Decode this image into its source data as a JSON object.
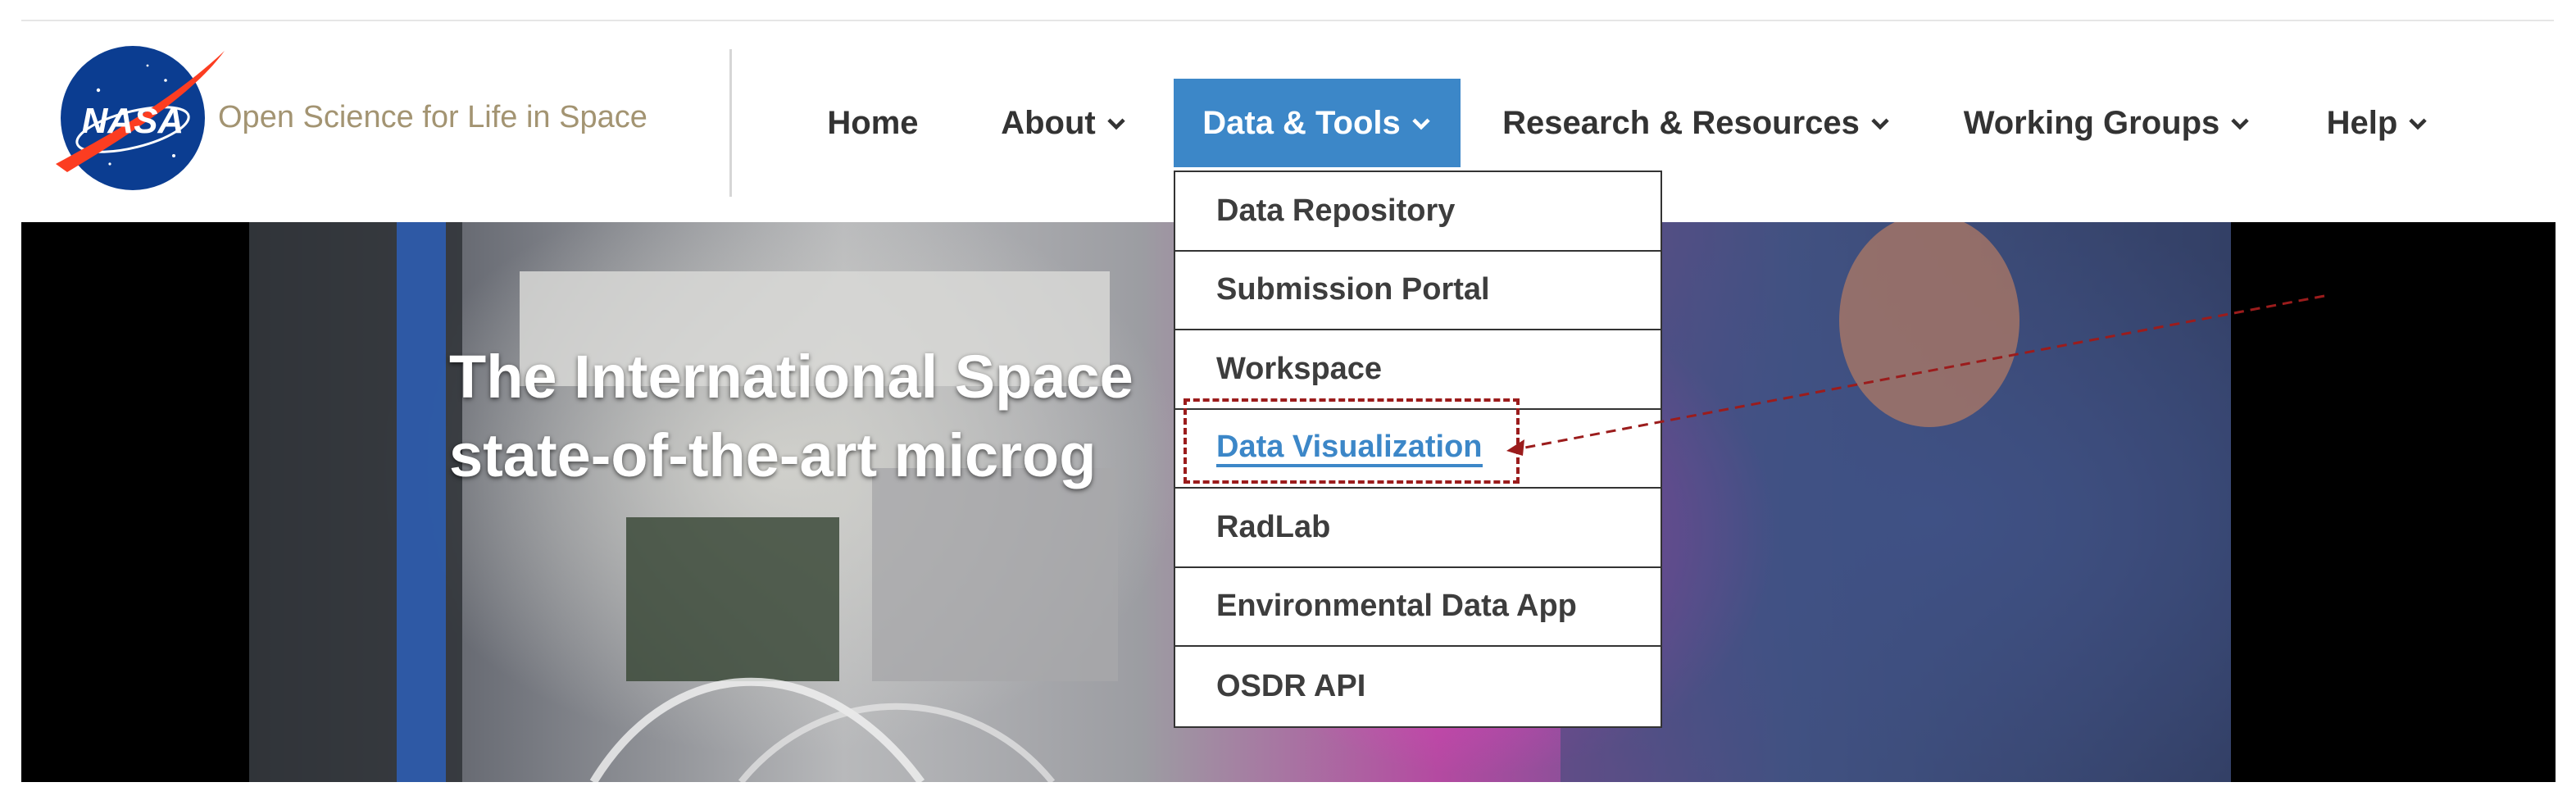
{
  "header": {
    "logo_text": "NASA",
    "site_title": "Open Science for Life in Space"
  },
  "nav": {
    "items": [
      {
        "label": "Home",
        "has_dropdown": false,
        "active": false
      },
      {
        "label": "About",
        "has_dropdown": true,
        "active": false
      },
      {
        "label": "Data & Tools",
        "has_dropdown": true,
        "active": true
      },
      {
        "label": "Research & Resources",
        "has_dropdown": true,
        "active": false
      },
      {
        "label": "Working Groups",
        "has_dropdown": true,
        "active": false
      },
      {
        "label": "Help",
        "has_dropdown": true,
        "active": false
      }
    ]
  },
  "dropdown": {
    "items": [
      {
        "label": "Data Repository"
      },
      {
        "label": "Submission Portal"
      },
      {
        "label": "Workspace"
      },
      {
        "label": "Data Visualization",
        "highlighted": true
      },
      {
        "label": "RadLab"
      },
      {
        "label": "Environmental Data App"
      },
      {
        "label": "OSDR API"
      }
    ]
  },
  "hero": {
    "line1": "The International Space",
    "line2": "state-of-the-art microg"
  },
  "colors": {
    "accent_blue": "#3c87c8",
    "title_tan": "#a39472",
    "annotation_red": "#9b1c1c",
    "nasa_blue": "#0b3d91",
    "nasa_red": "#fc3d21"
  },
  "icons": {
    "chevron": "chevron-down-icon",
    "logo": "nasa-meatball-logo"
  }
}
